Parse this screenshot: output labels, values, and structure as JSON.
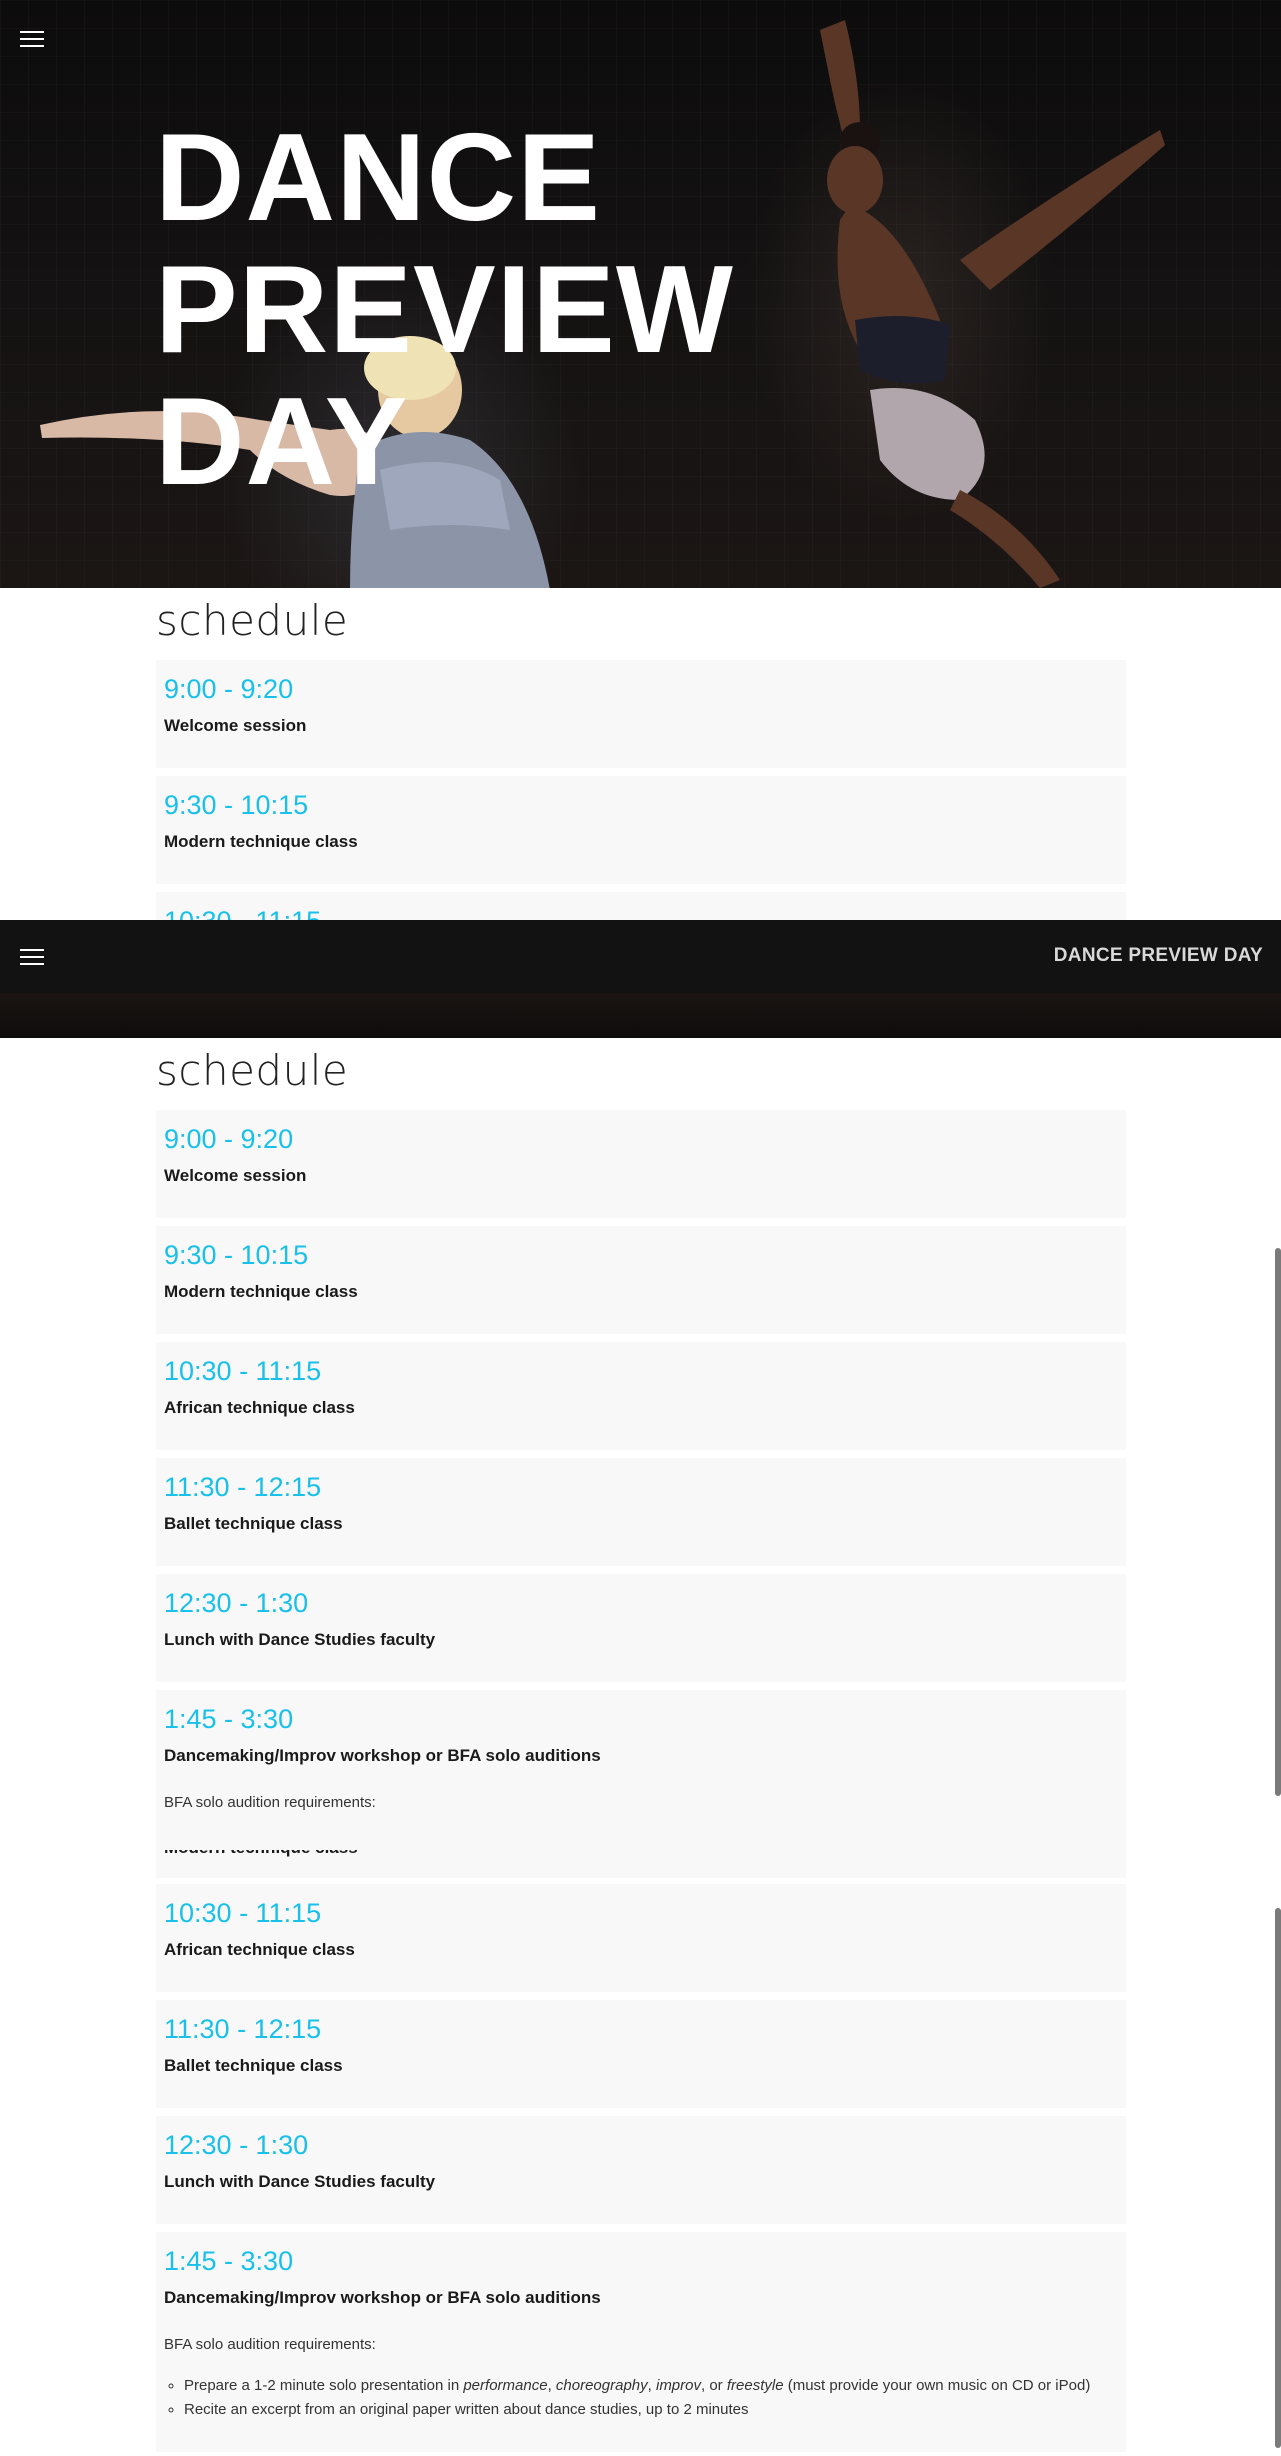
{
  "hero": {
    "title_lines": [
      "DANCE",
      "PREVIEW",
      "DAY"
    ]
  },
  "nav": {
    "menu_icon": "hamburger-menu-icon",
    "brand": "DANCE PREVIEW DAY"
  },
  "schedule": {
    "heading": "schedule",
    "items": [
      {
        "time": "9:00 - 9:20",
        "title": "Welcome session"
      },
      {
        "time": "9:30 - 10:15",
        "title": "Modern technique class"
      },
      {
        "time": "10:30 - 11:15",
        "title": "African technique class"
      },
      {
        "time": "11:30 - 12:15",
        "title": "Ballet technique class"
      },
      {
        "time": "12:30 - 1:30",
        "title": "Lunch with Dance Studies faculty"
      },
      {
        "time": "1:45 - 3:30",
        "title": "Dancemaking/Improv workshop or BFA solo auditions"
      }
    ],
    "partial_time": "10:30 - 11:15",
    "partial_title": "Modern technique class",
    "requirements_label": "BFA solo audition requirements:",
    "requirements": {
      "r1_prefix": "Prepare a 1-2 minute solo presentation in ",
      "r1_performance": "performance",
      "r1_comma1": ", ",
      "r1_choreography": "choreography",
      "r1_comma2": ", ",
      "r1_improv": "improv",
      "r1_or": ", or ",
      "r1_freestyle": "freestyle",
      "r1_suffix": " (must provide your own music on CD or iPod)",
      "r2": "Recite an excerpt from an original paper written about dance studies, up to 2 minutes"
    }
  },
  "colors": {
    "accent": "#18c0ea",
    "item_bg": "#f8f8f8",
    "nav_bg": "#121212"
  }
}
